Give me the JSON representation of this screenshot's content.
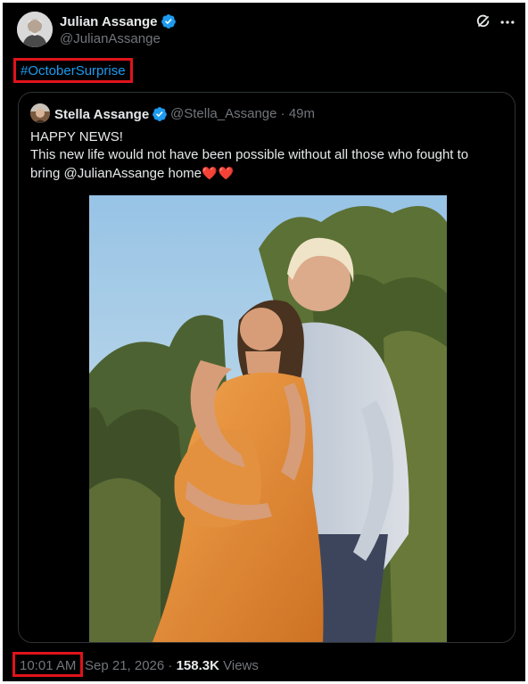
{
  "tweet": {
    "author": {
      "name": "Julian Assange",
      "handle": "@JulianAssange",
      "verified": true,
      "avatar_icon": "avatar-photo"
    },
    "hashtag": "#OctoberSurprise",
    "time": "10:01 AM",
    "date_sep": "·",
    "date": "Sep 21, 2026",
    "views_sep": "·",
    "views_count": "158.3K",
    "views_label": "Views",
    "icons": [
      "grok-icon",
      "more-icon"
    ]
  },
  "quoted": {
    "author": {
      "name": "Stella Assange",
      "handle": "@Stella_Assange",
      "sep": "·",
      "age": "49m",
      "verified": true
    },
    "lines": [
      "HAPPY NEWS!",
      "This new life would not have been possible without all those who fought to",
      "bring @JulianAssange home"
    ],
    "emoji": "❤️❤️",
    "image": "photo of couple outdoors at sunset, woman in orange dress, man in light blue shirt, trees in background"
  },
  "colors": {
    "background": "#000000",
    "text": "#e7e9ea",
    "muted": "#71767b",
    "link": "#1d9bf0",
    "verified": "#1d9bf0",
    "highlight": "#e0131b",
    "heart": "#e0245e"
  }
}
